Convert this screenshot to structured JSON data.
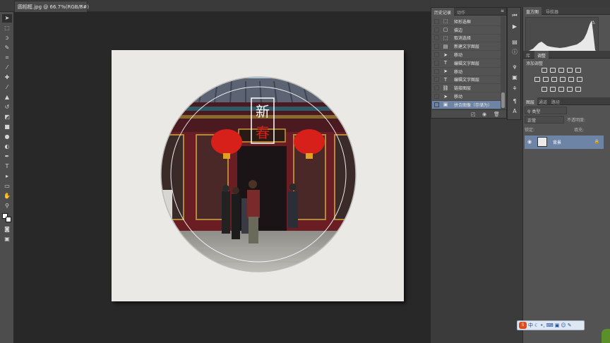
{
  "document": {
    "tab_title": "圆相框.jpg @ 66.7%(RGB/8#)",
    "close_label": "×"
  },
  "canvas": {
    "overlay_text_1": "新",
    "overlay_text_2": "春"
  },
  "history_panel": {
    "tabs": [
      "历史记录",
      "动作"
    ],
    "items": [
      {
        "icon": "rect-marquee-icon",
        "label": "矩形选框"
      },
      {
        "icon": "stroke-icon",
        "label": "描边"
      },
      {
        "icon": "deselect-icon",
        "label": "取消选择"
      },
      {
        "icon": "new-layer-icon",
        "label": "新建文字图层"
      },
      {
        "icon": "move-icon",
        "label": "移动"
      },
      {
        "icon": "text-icon",
        "label": "编辑文字图层"
      },
      {
        "icon": "move-icon",
        "label": "移动"
      },
      {
        "icon": "text-icon",
        "label": "编辑文字图层"
      },
      {
        "icon": "link-layer-icon",
        "label": "链接图层"
      },
      {
        "icon": "move-icon",
        "label": "移动"
      },
      {
        "icon": "flatten-icon",
        "label": "拼合图像（存储为）"
      }
    ],
    "selected_index": 10
  },
  "right_panels": {
    "histogram_tabs": [
      "直方图",
      "导航器"
    ],
    "adjust_tabs": [
      "库",
      "调整"
    ],
    "adjust_title": "添加调整",
    "layers_tabs": [
      "图层",
      "通道",
      "路径"
    ],
    "filter_kind": "类型",
    "blend_mode": "正常",
    "opacity_label": "不透明度:",
    "lock_label": "锁定:",
    "fill_label": "填充:",
    "layer_name": "背景"
  },
  "taskbar": {
    "logo": "S",
    "ime": "中"
  }
}
